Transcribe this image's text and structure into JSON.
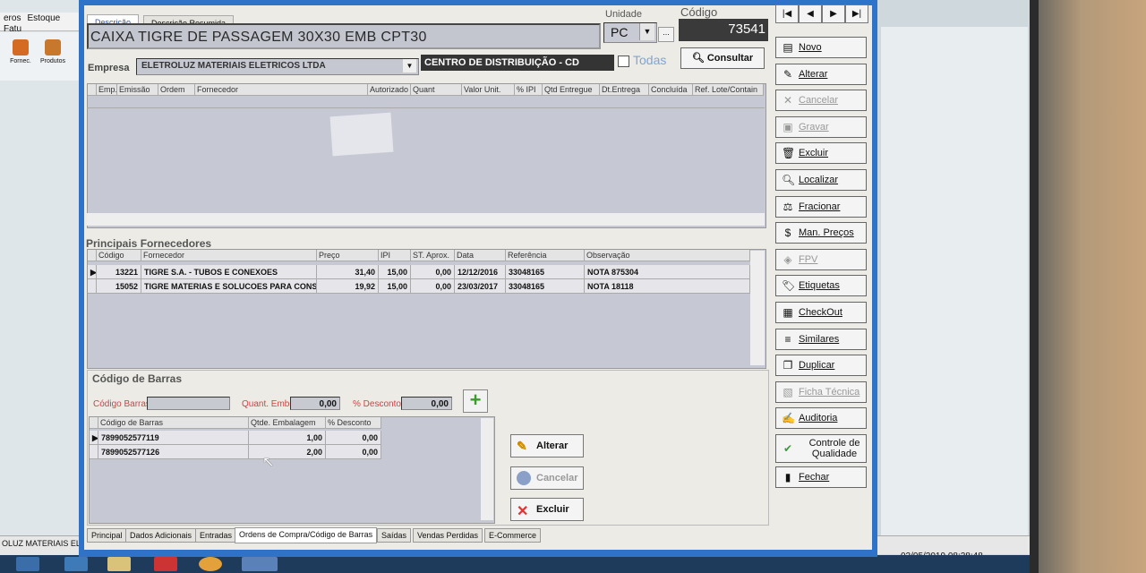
{
  "background_app": {
    "menu": [
      "eros",
      "Estoque",
      "Fatu"
    ],
    "tools": [
      "Fornec.",
      "Produtos"
    ],
    "status_left": "OLUZ MATERIAIS EL",
    "status_datetime": "02/05/2019 08:28:48"
  },
  "header": {
    "tabs": [
      "Descrição",
      "Descrição Resumida"
    ],
    "description": "CAIXA TIGRE DE PASSAGEM 30X30 EMB CPT30",
    "unidade_label": "Unidade",
    "unidade_value": "PC",
    "unidade_dots": "...",
    "codigo_label": "Código",
    "codigo_value": "73541",
    "nav": [
      "|◀",
      "◀",
      "▶",
      "▶|"
    ]
  },
  "empresa": {
    "label": "Empresa",
    "value": "ELETROLUZ MATERIAIS ELETRICOS LTDA",
    "centro": "CENTRO DE DISTRIBUIÇÃO - CD",
    "todas_label": "Todas",
    "consultar_label": "Consultar"
  },
  "orders_grid": {
    "columns": [
      "Emp.",
      "Emissão",
      "Ordem",
      "Fornecedor",
      "Autorizado",
      "Quant",
      "Valor Unit.",
      "% IPI",
      "Qtd Entregue",
      "Dt.Entrega",
      "Concluída",
      "Ref. Lote/Contain"
    ]
  },
  "suppliers": {
    "title": "Principais Fornecedores",
    "columns": [
      "Código",
      "Fornecedor",
      "Preço",
      "IPI",
      "ST. Aprox.",
      "Data",
      "Referência",
      "Observação"
    ],
    "rows": [
      [
        "13221",
        "TIGRE S.A. - TUBOS E CONEXOES",
        "31,40",
        "15,00",
        "0,00",
        "12/12/2016",
        "33048165",
        "NOTA 875304"
      ],
      [
        "15052",
        "TIGRE MATERIAS E SOLUCOES PARA CONS",
        "19,92",
        "15,00",
        "0,00",
        "23/03/2017",
        "33048165",
        "NOTA 18118"
      ]
    ]
  },
  "barcodes": {
    "title": "Código de Barras",
    "codigo_label": "Código Barras",
    "quant_label": "Quant. Emb.",
    "quant_value": "0,00",
    "desconto_label": "% Desconto",
    "desconto_value": "0,00",
    "columns": [
      "Código de Barras",
      "Qtde. Embalagem",
      "% Desconto"
    ],
    "rows": [
      [
        "7899052577119",
        "1,00",
        "0,00"
      ],
      [
        "7899052577126",
        "2,00",
        "0,00"
      ]
    ],
    "alterar_label": "Alterar",
    "cancelar_label": "Cancelar",
    "excluir_label": "Excluir"
  },
  "side_buttons": [
    {
      "label": "Novo",
      "icon": "new-doc-icon",
      "enabled": true
    },
    {
      "label": "Alterar",
      "icon": "edit-icon",
      "enabled": true
    },
    {
      "label": "Cancelar",
      "icon": "cancel-icon",
      "enabled": false
    },
    {
      "label": "Gravar",
      "icon": "save-icon",
      "enabled": false
    },
    {
      "label": "Excluir",
      "icon": "trash-icon",
      "enabled": true
    },
    {
      "label": "Localizar",
      "icon": "search-icon",
      "enabled": true
    },
    {
      "label": "Fracionar",
      "icon": "split-icon",
      "enabled": true
    },
    {
      "label": "Man. Preços",
      "icon": "price-icon",
      "enabled": true
    },
    {
      "label": "FPV",
      "icon": "fpv-icon",
      "enabled": false
    },
    {
      "label": "Etiquetas",
      "icon": "label-icon",
      "enabled": true
    },
    {
      "label": "CheckOut",
      "icon": "checkout-icon",
      "enabled": true
    },
    {
      "label": "Similares",
      "icon": "similar-icon",
      "enabled": true
    },
    {
      "label": "Duplicar",
      "icon": "duplicate-icon",
      "enabled": true
    },
    {
      "label": "Ficha Técnica",
      "icon": "datasheet-icon",
      "enabled": false
    },
    {
      "label": "Auditoria",
      "icon": "audit-icon",
      "enabled": true
    },
    {
      "label": "Controle de Qualidade",
      "icon": "quality-icon",
      "enabled": true
    },
    {
      "label": "Fechar",
      "icon": "close-icon",
      "enabled": true
    }
  ],
  "bottom_tabs": [
    "Principal",
    "Dados Adicionais",
    "Entradas",
    "Ordens de Compra/Código de Barras",
    "Saídas",
    "Vendas Perdidas",
    "E-Commerce"
  ]
}
